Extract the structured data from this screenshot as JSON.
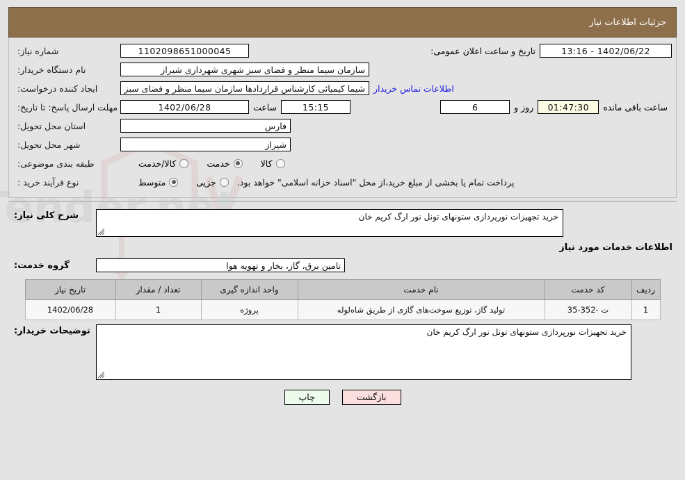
{
  "header": {
    "title": "جزئیات اطلاعات نیاز"
  },
  "form": {
    "need_number_label": "شماره نیاز:",
    "need_number_value": "1102098651000045",
    "announce_label": "تاریخ و ساعت اعلان عمومی:",
    "announce_value": "1402/06/22 - 13:16",
    "buyer_org_label": "نام دستگاه خریدار:",
    "buyer_org_value": "سازمان سیما منظر و فضای سبز شهری شهرداری شیراز",
    "creator_label": "ایجاد کننده درخواست:",
    "creator_value": "شیما کیمیائی کارشناس قراردادها سازمان سیما منظر و فضای سبز شهری شهـ",
    "contact_link": "اطلاعات تماس خریدار",
    "deadline_label": "مهلت ارسال پاسخ: تا تاریخ:",
    "deadline_date": "1402/06/28",
    "hour_label": "ساعت",
    "deadline_time": "15:15",
    "days_value": "6",
    "days_label": "روز و",
    "countdown_value": "01:47:30",
    "remaining_label": "ساعت باقی مانده",
    "province_label": "استان محل تحویل:",
    "province_value": "فارس",
    "city_label": "شهر محل تحویل:",
    "city_value": "شیراز",
    "category_label": "طبقه بندی موضوعی:",
    "category_options": [
      {
        "label": "کالا",
        "selected": false
      },
      {
        "label": "خدمت",
        "selected": true
      },
      {
        "label": "کالا/خدمت",
        "selected": false
      }
    ],
    "process_label": "نوع فرآیند خرید :",
    "process_options": [
      {
        "label": "جزیی",
        "selected": false
      },
      {
        "label": "متوسط",
        "selected": true
      }
    ],
    "payment_note": "پرداخت تمام یا بخشی از مبلغ خرید،از محل \"اسناد خزانه اسلامی\" خواهد بود."
  },
  "description": {
    "label": "شرح کلی نیاز:",
    "value": "خرید تجهیزات نورپردازی ستونهای تونل نور ارگ کریم خان"
  },
  "services": {
    "heading": "اطلاعات خدمات مورد نیاز",
    "group_label": "گروه خدمت:",
    "group_value": "تامین برق، گاز، بخار و تهویه هوا",
    "columns": [
      "ردیف",
      "کد خدمت",
      "نام خدمت",
      "واحد اندازه گیری",
      "تعداد / مقدار",
      "تاریخ نیاز"
    ],
    "rows": [
      {
        "radif": "1",
        "code": "ت -352-35",
        "name": "تولید گاز، توزیع سوخت‌های گازی از طریق شاه‌لوله",
        "unit": "پروژه",
        "qty": "1",
        "date": "1402/06/28"
      }
    ]
  },
  "buyer_notes": {
    "label": "توضیحات خریدار:",
    "value": "خرید تجهیزات نورپردازی ستونهای تونل نور ارگ کریم خان"
  },
  "footer": {
    "print_label": "چاپ",
    "back_label": "بازگشت"
  }
}
